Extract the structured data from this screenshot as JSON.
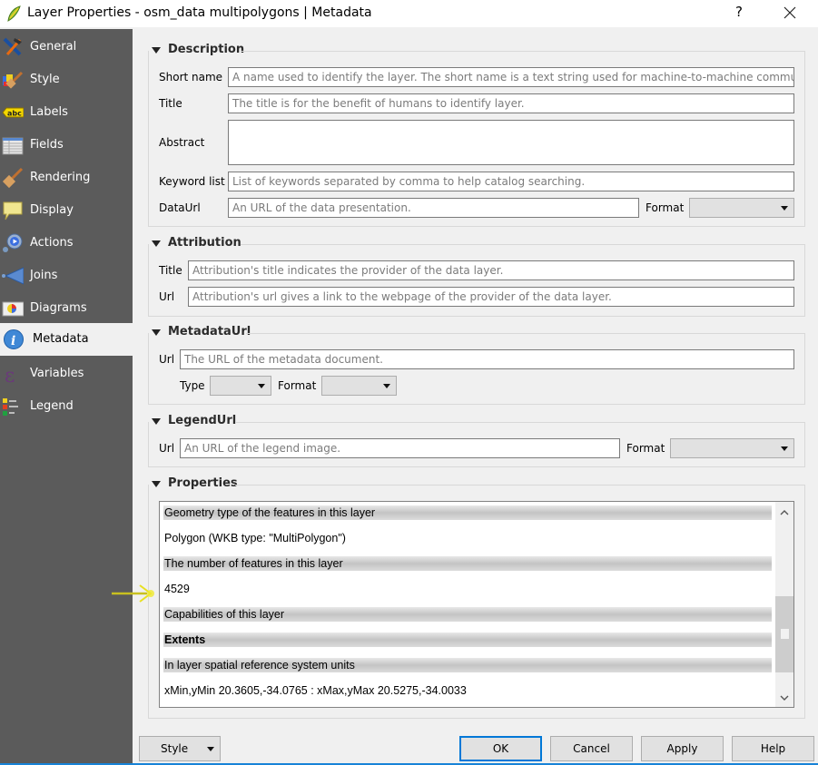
{
  "window": {
    "title": "Layer Properties - osm_data multipolygons | Metadata",
    "help_label": "?",
    "close_icon": "close-icon",
    "app_icon": "qgis-icon"
  },
  "sidebar": {
    "items": [
      {
        "label": "General",
        "icon": "general-tools-icon",
        "active": false
      },
      {
        "label": "Style",
        "icon": "style-brush-icon",
        "active": false
      },
      {
        "label": "Labels",
        "icon": "labels-abc-icon",
        "active": false
      },
      {
        "label": "Fields",
        "icon": "fields-table-icon",
        "active": false
      },
      {
        "label": "Rendering",
        "icon": "rendering-brush-icon",
        "active": false
      },
      {
        "label": "Display",
        "icon": "display-speech-bubble-icon",
        "active": false
      },
      {
        "label": "Actions",
        "icon": "actions-gear-icon",
        "active": false
      },
      {
        "label": "Joins",
        "icon": "joins-arrow-icon",
        "active": false
      },
      {
        "label": "Diagrams",
        "icon": "diagrams-pie-icon",
        "active": false
      },
      {
        "label": "Metadata",
        "icon": "metadata-info-icon",
        "active": true
      },
      {
        "label": "Variables",
        "icon": "variables-epsilon-icon",
        "active": false
      },
      {
        "label": "Legend",
        "icon": "legend-icon",
        "active": false
      }
    ]
  },
  "description": {
    "title": "Description",
    "short_name_label": "Short name",
    "short_name_placeholder": "A name used to identify the layer. The short name is a text string used for machine-to-machine communic...",
    "title_label": "Title",
    "title_placeholder": "The title is for the benefit of humans to identify layer.",
    "abstract_label": "Abstract",
    "abstract_value": "",
    "keyword_label": "Keyword list",
    "keyword_placeholder": "List of keywords separated by comma to help catalog searching.",
    "dataurl_label": "DataUrl",
    "dataurl_placeholder": "An URL of the data presentation.",
    "format_label": "Format",
    "format_value": ""
  },
  "attribution": {
    "title": "Attribution",
    "title_label": "Title",
    "title_placeholder": "Attribution's title indicates the provider of the data layer.",
    "url_label": "Url",
    "url_placeholder": "Attribution's url gives a link to the webpage of the provider of the data layer."
  },
  "metadataurl": {
    "title": "MetadataUrl",
    "url_label": "Url",
    "url_placeholder": "The URL of the metadata document.",
    "type_label": "Type",
    "type_value": "",
    "format_label": "Format",
    "format_value": ""
  },
  "legendurl": {
    "title": "LegendUrl",
    "url_label": "Url",
    "url_placeholder": "An URL of the legend image.",
    "format_label": "Format",
    "format_value": ""
  },
  "properties": {
    "title": "Properties",
    "rows": [
      {
        "text": "Geometry type of the features in this layer",
        "kind": "head"
      },
      {
        "text": "Polygon (WKB type: \"MultiPolygon\")",
        "kind": "value"
      },
      {
        "text": "The number of features in this layer",
        "kind": "head"
      },
      {
        "text": "4529",
        "kind": "value"
      },
      {
        "text": "Capabilities of this layer",
        "kind": "head"
      },
      {
        "text": "Extents",
        "kind": "head-bold"
      },
      {
        "text": "In layer spatial reference system units",
        "kind": "head"
      },
      {
        "text": "xMin,yMin 20.3605,-34.0765 : xMax,yMax 20.5275,-34.0033",
        "kind": "value"
      }
    ]
  },
  "buttons": {
    "style": "Style",
    "ok": "OK",
    "cancel": "Cancel",
    "apply": "Apply",
    "help": "Help"
  },
  "colors": {
    "sidebar_bg": "#5b5b5b",
    "dialog_bg": "#f0f0f0",
    "default_button_border": "#0078d7",
    "annotation_arrow": "#e8e020"
  }
}
